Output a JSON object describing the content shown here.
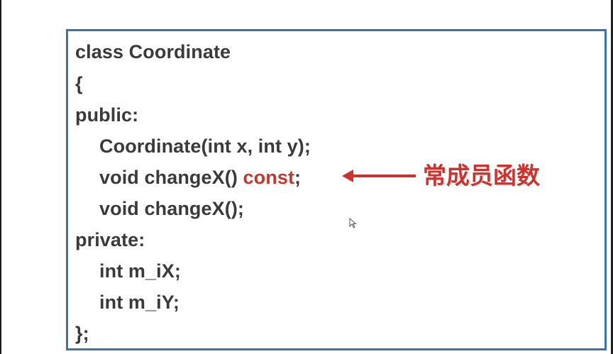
{
  "code": {
    "line1": "class Coordinate",
    "line2": "{",
    "line3": "public:",
    "line4": "Coordinate(int x, int y);",
    "line5_pre": "void changeX() ",
    "line5_kw": "const",
    "line5_post": ";",
    "line6": "void changeX();",
    "line7": "private:",
    "line8": "int m_iX;",
    "line9": "int m_iY;",
    "line10": "};"
  },
  "annotation": {
    "label": "常成员函数"
  },
  "colors": {
    "border": "#3f6fb5",
    "code_text": "#3a3a3a",
    "highlight": "#c0392b",
    "annotation": "#d0312d"
  },
  "icons": {
    "arrow": "arrow-left-icon",
    "cursor": "mouse-cursor-icon"
  }
}
